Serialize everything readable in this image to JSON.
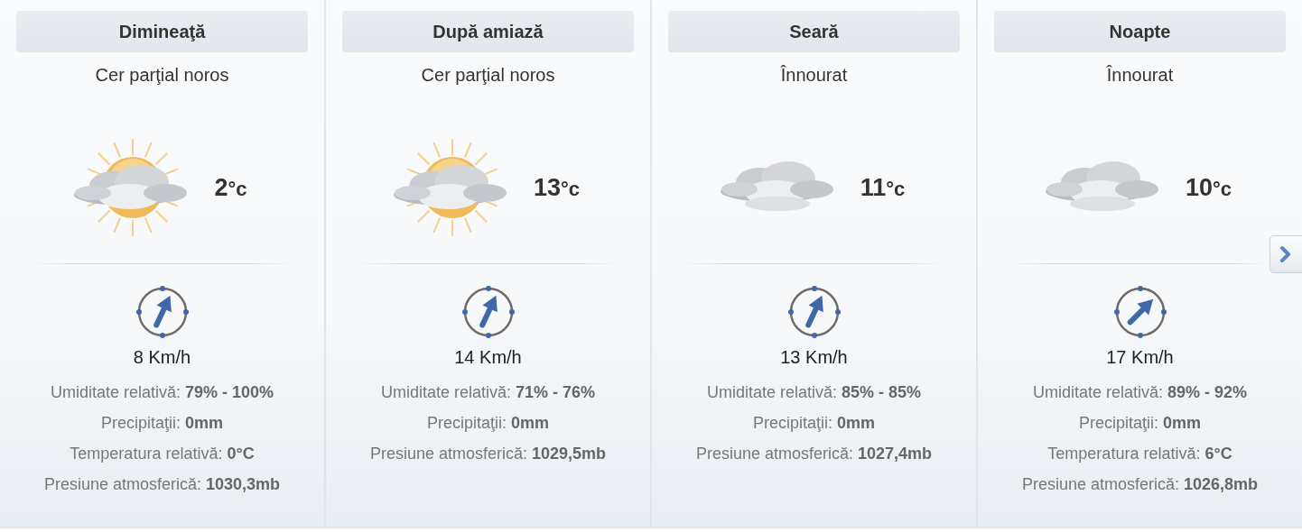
{
  "periods": [
    {
      "title": "Dimineaţă",
      "condition": "Cer parţial noros",
      "kind": "partly-cloudy",
      "temp": "2",
      "unit": "°c",
      "wind": {
        "kind": "north-northeast",
        "speed": "8 Km/h"
      },
      "details": [
        "Umiditate relativă: **79% - 100%**",
        "Precipitaţii: **0mm**",
        "Temperatura relativă: **0°C**",
        "Presiune atmosferică: **1030,3mb**"
      ]
    },
    {
      "title": "După amiază",
      "condition": "Cer parţial noros",
      "kind": "partly-cloudy",
      "temp": "13",
      "unit": "°c",
      "wind": {
        "kind": "north-northeast",
        "speed": "14 Km/h"
      },
      "details": [
        "Umiditate relativă: **71% - 76%**",
        "Precipitaţii: **0mm**",
        "Presiune atmosferică: **1029,5mb**"
      ]
    },
    {
      "title": "Seară",
      "condition": "Înnourat",
      "kind": "cloudy",
      "temp": "11",
      "unit": "°c",
      "wind": {
        "kind": "north-northeast",
        "speed": "13 Km/h"
      },
      "details": [
        "Umiditate relativă: **85% - 85%**",
        "Precipitaţii: **0mm**",
        "Presiune atmosferică: **1027,4mb**"
      ]
    },
    {
      "title": "Noapte",
      "condition": "Înnourat",
      "kind": "cloudy",
      "temp": "10",
      "unit": "°c",
      "wind": {
        "kind": "northeast",
        "speed": "17 Km/h"
      },
      "details": [
        "Umiditate relativă: **89% - 92%**",
        "Precipitaţii: **0mm**",
        "Temperatura relativă: **6°C**",
        "Presiune atmosferică: **1026,8mb**"
      ]
    }
  ]
}
